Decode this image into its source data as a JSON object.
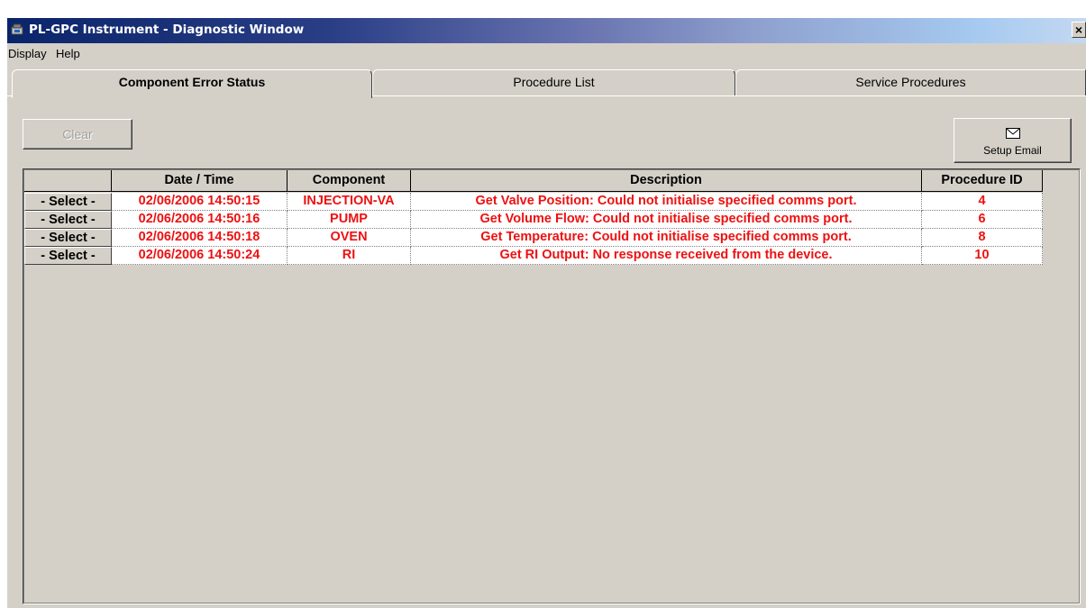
{
  "window": {
    "title": "PL-GPC Instrument - Diagnostic Window",
    "close_label": "×"
  },
  "menu": [
    "Display",
    "Help"
  ],
  "tabs": [
    {
      "label": "Component Error Status",
      "active": true
    },
    {
      "label": "Procedure List",
      "active": false
    },
    {
      "label": "Service Procedures",
      "active": false
    }
  ],
  "toolbar": {
    "clear_label": "Clear",
    "setup_email_label": "Setup Email"
  },
  "table": {
    "columns": [
      "",
      "Date / Time",
      "Component",
      "Description",
      "Procedure ID"
    ],
    "rows": [
      {
        "select": "- Select -",
        "datetime": "02/06/2006 14:50:15",
        "component": "INJECTION-VA",
        "description": "Get Valve Position: Could not initialise specified comms port.",
        "procedure_id": "4"
      },
      {
        "select": "- Select -",
        "datetime": "02/06/2006 14:50:16",
        "component": "PUMP",
        "description": "Get Volume Flow: Could not initialise specified comms port.",
        "procedure_id": "6"
      },
      {
        "select": "- Select -",
        "datetime": "02/06/2006 14:50:18",
        "component": "OVEN",
        "description": "Get Temperature: Could not initialise specified comms port.",
        "procedure_id": "8"
      },
      {
        "select": "- Select -",
        "datetime": "02/06/2006 14:50:24",
        "component": "RI",
        "description": "Get RI Output: No response received from the device.",
        "procedure_id": "10"
      }
    ]
  },
  "colors": {
    "error_text": "#ee1111",
    "titlebar_start": "#0a246a",
    "face": "#d4d0c8"
  }
}
